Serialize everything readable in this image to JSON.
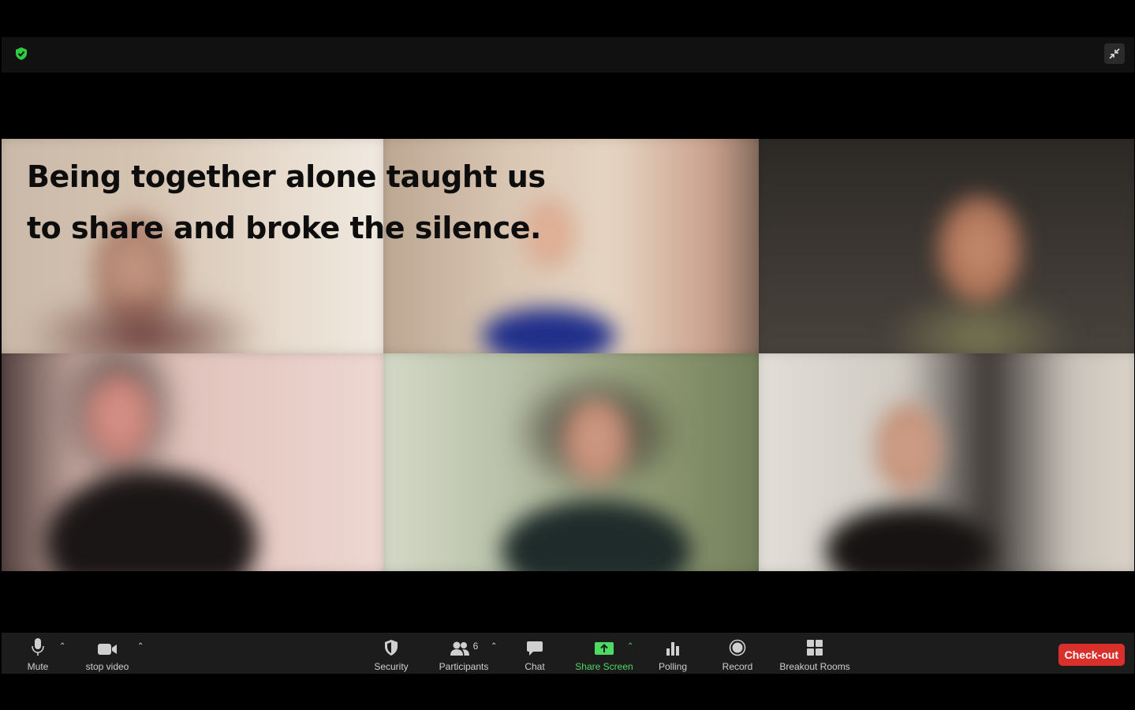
{
  "caption": {
    "line1": "Being together alone taught us",
    "line2": "to share and broke the silence."
  },
  "top_bar": {
    "security_icon": "shield-check-icon",
    "exit_fullscreen_icon": "collapse-arrows-icon"
  },
  "participants_grid": [
    {
      "position": "top-left",
      "bg": "#b7927a"
    },
    {
      "position": "top-middle",
      "bg": "#c8b09b"
    },
    {
      "position": "top-right",
      "bg": "#3a3530"
    },
    {
      "position": "bottom-left",
      "bg": "#d8b8b0"
    },
    {
      "position": "bottom-middle",
      "bg": "#8d9473"
    },
    {
      "position": "bottom-right",
      "bg": "#d5d0c8"
    }
  ],
  "toolbar": {
    "mute": "Mute",
    "stop_video": "stop video",
    "security": "Security",
    "participants": "Participants",
    "participants_count": "6",
    "chat": "Chat",
    "share_screen": "Share Screen",
    "polling": "Polling",
    "record": "Record",
    "breakout_rooms": "Breakout Rooms",
    "checkout": "Check-out"
  },
  "colors": {
    "share_green": "#4cd964",
    "checkout_red": "#d9302c",
    "toolbar_bg": "#1c1c1c"
  }
}
